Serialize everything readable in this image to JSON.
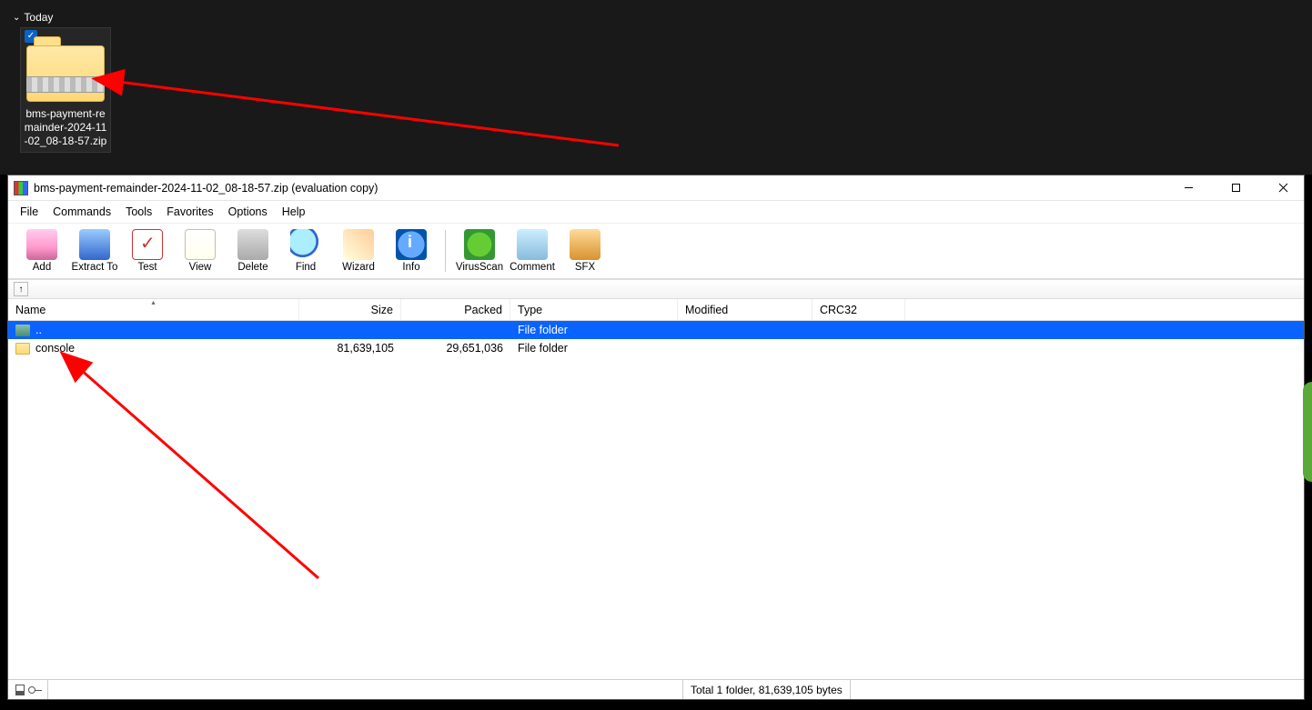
{
  "explorer": {
    "group_label": "Today",
    "file_label": "bms-payment-remainder-2024-11-02_08-18-57.zip"
  },
  "window": {
    "title": "bms-payment-remainder-2024-11-02_08-18-57.zip (evaluation copy)"
  },
  "menu": {
    "file": "File",
    "commands": "Commands",
    "tools": "Tools",
    "favorites": "Favorites",
    "options": "Options",
    "help": "Help"
  },
  "toolbar": {
    "add": "Add",
    "extract": "Extract To",
    "test": "Test",
    "view": "View",
    "delete": "Delete",
    "find": "Find",
    "wizard": "Wizard",
    "info": "Info",
    "virus": "VirusScan",
    "comment": "Comment",
    "sfx": "SFX"
  },
  "addressbar": {
    "path": ""
  },
  "columns": {
    "name": "Name",
    "size": "Size",
    "packed": "Packed",
    "type": "Type",
    "modified": "Modified",
    "crc": "CRC32"
  },
  "rows": {
    "parent": {
      "name": "..",
      "type": "File folder"
    },
    "r0": {
      "name": "console",
      "size": "81,639,105",
      "packed": "29,651,036",
      "type": "File folder",
      "modified": "",
      "crc": ""
    }
  },
  "status": {
    "total": "Total 1 folder, 81,639,105 bytes"
  }
}
